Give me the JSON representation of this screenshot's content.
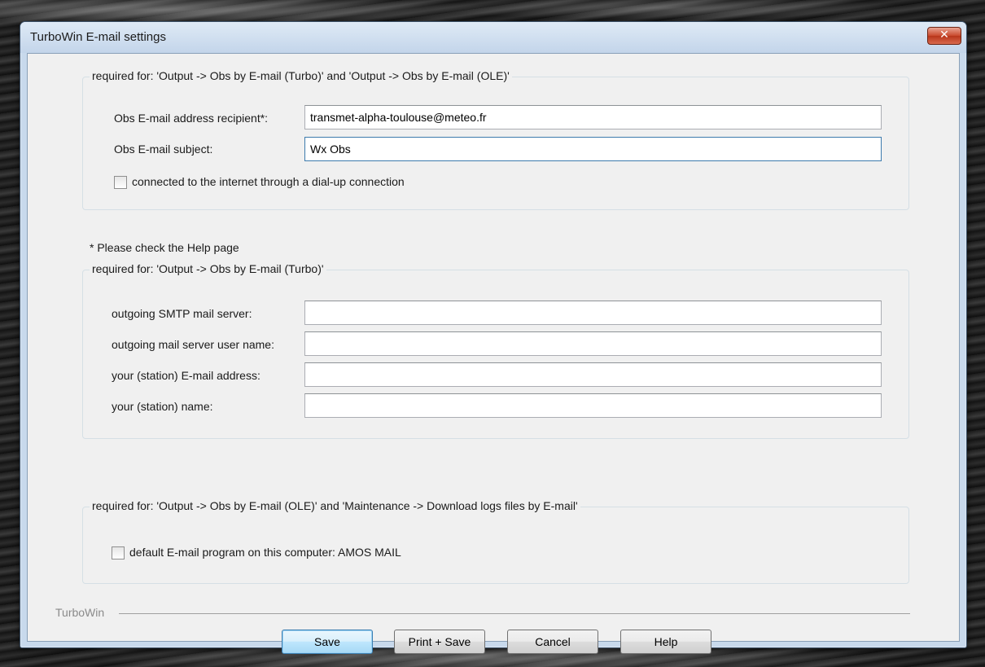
{
  "window": {
    "title": "TurboWin E-mail settings",
    "close_glyph": "✕"
  },
  "group_common": {
    "legend": "required for: 'Output -> Obs by E-mail (Turbo)' and 'Output -> Obs by E-mail (OLE)'",
    "recipient_label": "Obs E-mail address recipient*:",
    "recipient_value": "transmet-alpha-toulouse@meteo.fr",
    "subject_label": "Obs E-mail subject:",
    "subject_value": "Wx Obs",
    "dialup_label": "connected to the internet through a dial-up connection",
    "dialup_checked": false
  },
  "help_note": "* Please check the Help page",
  "group_turbo": {
    "legend": "required for: 'Output -> Obs by E-mail (Turbo)'",
    "smtp_label": "outgoing SMTP mail server:",
    "smtp_value": "",
    "username_label": "outgoing mail server user name:",
    "username_value": "",
    "station_email_label": "your (station) E-mail address:",
    "station_email_value": "",
    "station_name_label": "your (station) name:",
    "station_name_value": ""
  },
  "group_ole": {
    "legend": "required for: 'Output -> Obs by E-mail (OLE)' and 'Maintenance -> Download logs files by E-mail'",
    "default_program_label": "default E-mail program on this computer: AMOS MAIL",
    "default_program_checked": false
  },
  "footer": {
    "brand": "TurboWin",
    "save_label": "Save",
    "print_save_label": "Print + Save",
    "cancel_label": "Cancel",
    "help_label": "Help"
  },
  "colors": {
    "title_bar": "#c8d9ec",
    "close_button": "#c9492c",
    "default_button": "#bee6fd"
  }
}
